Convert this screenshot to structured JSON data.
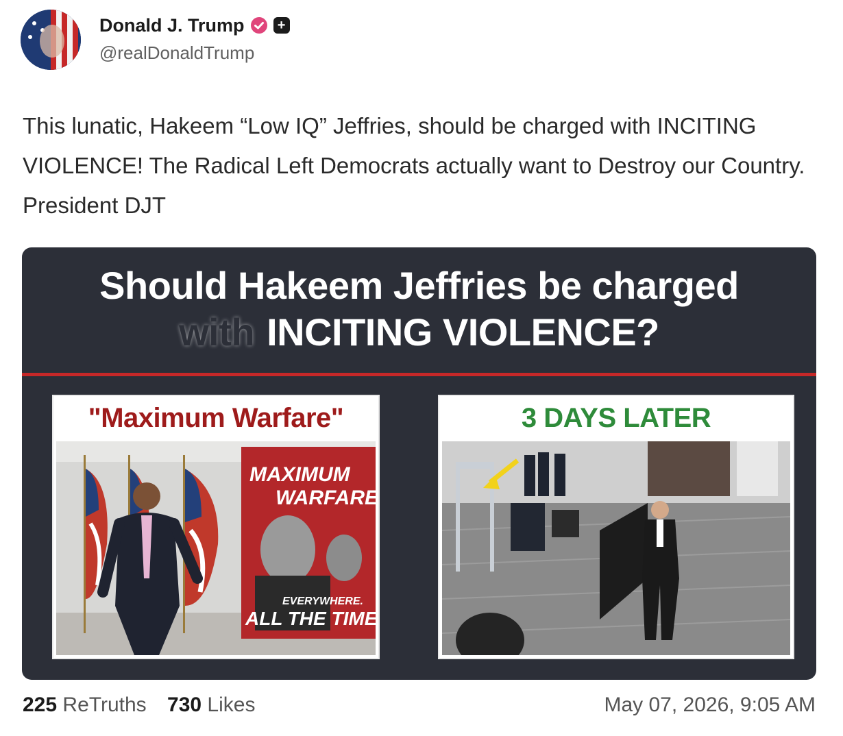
{
  "author": {
    "display_name": "Donald J. Trump",
    "handle": "@realDonaldTrump",
    "verified_icon": "verified-badge-icon",
    "subscribe_icon": "plus-icon",
    "plus_symbol": "+"
  },
  "post": {
    "text": "This lunatic, Hakeem “Low IQ” Jeffries, should be charged with INCITING VIOLENCE! The Radical Left Democrats actually want to Destroy our Country. President DJT"
  },
  "card": {
    "title_line1": "Should Hakeem Jeffries be charged",
    "title_blurred_word": "with",
    "title_line2": "INCITING VIOLENCE?",
    "left_label": "\"Maximum Warfare\"",
    "right_label": "3 DAYS LATER",
    "sign_line1": "MAXIMUM",
    "sign_line2": "WARFARE",
    "sign_line3": "EVERYWHERE.",
    "sign_line4": "ALL THE TIME.",
    "colors": {
      "background": "#2c2f38",
      "rule": "#c62828",
      "left_label": "#9e1b1b",
      "right_label": "#2e8b3a"
    }
  },
  "footer": {
    "retruths_count": "225",
    "retruths_label": "ReTruths",
    "likes_count": "730",
    "likes_label": "Likes",
    "timestamp": "May 07, 2026, 9:05 AM"
  }
}
